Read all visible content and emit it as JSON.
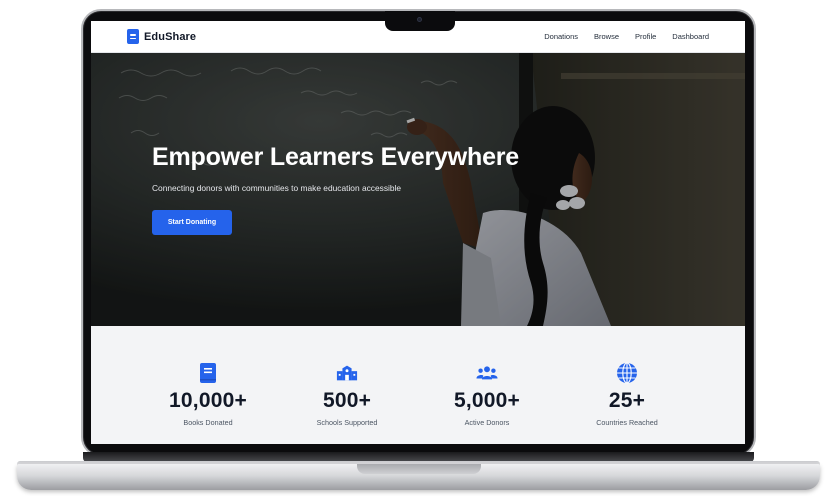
{
  "brand": {
    "name": "EduShare",
    "icon": "book-icon",
    "color": "#2563eb"
  },
  "nav": {
    "links": [
      "Donations",
      "Browse",
      "Profile",
      "Dashboard"
    ]
  },
  "hero": {
    "title": "Empower Learners Everywhere",
    "subtitle": "Connecting donors with communities to make education accessible",
    "cta_label": "Start Donating",
    "image": "student-writing-on-chalkboard"
  },
  "stats": [
    {
      "icon": "book-icon",
      "value": "10,000+",
      "label": "Books Donated"
    },
    {
      "icon": "school-icon",
      "value": "500+",
      "label": "Schools Supported"
    },
    {
      "icon": "users-icon",
      "value": "5,000+",
      "label": "Active Donors"
    },
    {
      "icon": "globe-icon",
      "value": "25+",
      "label": "Countries Reached"
    }
  ],
  "colors": {
    "accent": "#2563eb",
    "text_dark": "#111827",
    "stats_background": "#f3f4f6"
  }
}
